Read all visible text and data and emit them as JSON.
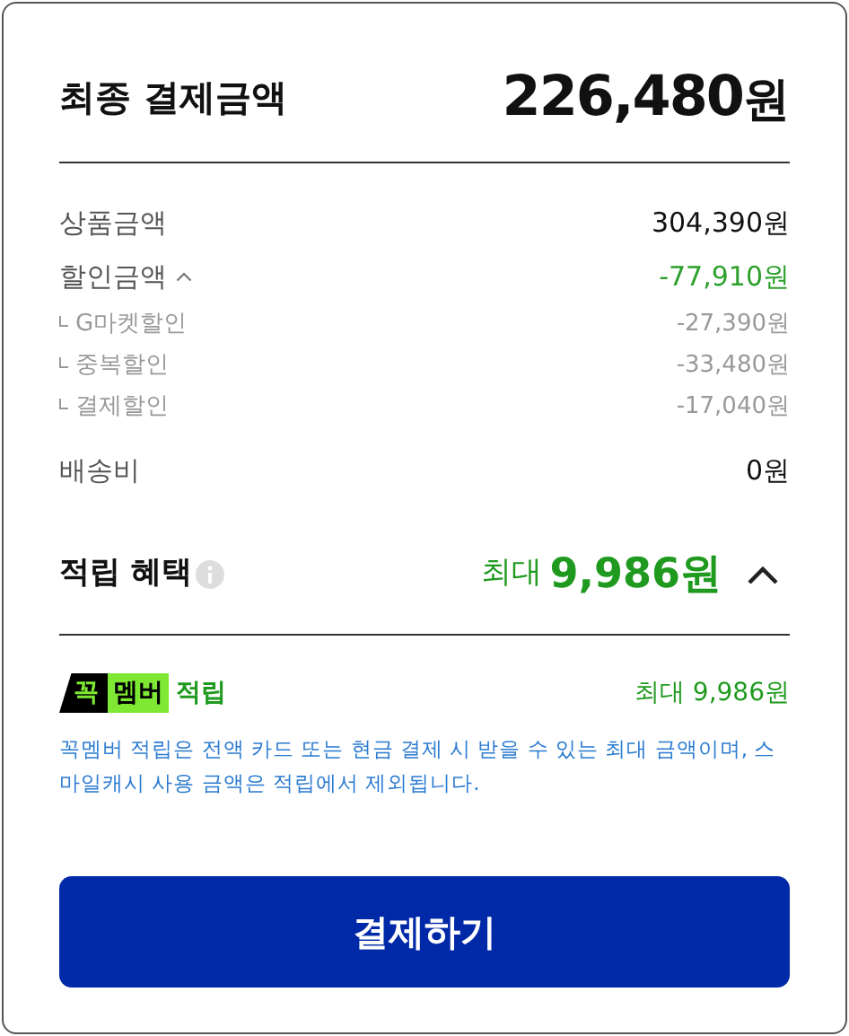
{
  "total": {
    "label": "최종 결제금액",
    "amount": "226,480",
    "unit": "원"
  },
  "rows": [
    {
      "kind": "plain",
      "label": "상품금액",
      "value": "304,390원"
    },
    {
      "kind": "discount",
      "label": "할인금액",
      "value": "-77,910원",
      "expanded": true,
      "children": [
        {
          "label": "G마켓할인",
          "value": "-27,390원"
        },
        {
          "label": "중복할인",
          "value": "-33,480원"
        },
        {
          "label": "결제할인",
          "value": "-17,040원"
        }
      ]
    },
    {
      "kind": "plain",
      "label": "배송비",
      "value": "0원"
    }
  ],
  "rewards": {
    "label": "적립 혜택",
    "prefix": "최대",
    "amount": "9,986",
    "unit": "원",
    "expanded": true
  },
  "member": {
    "badge_first": "꼭",
    "badge_second": "멤버",
    "label": "적립",
    "value": "최대 9,986원",
    "note": "꼭멤버 적립은 전액 카드 또는 현금 결제 시 받을 수 있는 최대 금액이며, 스마일캐시 사용 금액은 적립에서 제외됩니다."
  },
  "pay_button": "결제하기"
}
